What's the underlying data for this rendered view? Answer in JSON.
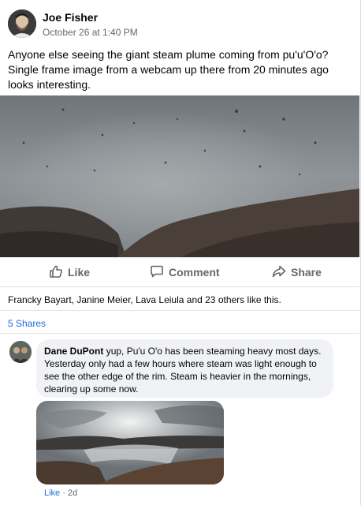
{
  "post": {
    "author": "Joe Fisher",
    "timestamp": "October 26 at 1:40 PM",
    "text": "Anyone else seeing the giant steam plume coming from pu'u'O'o? Single frame image from a webcam up there from 20 minutes ago looks interesting."
  },
  "actions": {
    "like": "Like",
    "comment": "Comment",
    "share": "Share"
  },
  "reactions": {
    "summary": "Francky Bayart, Janine Meier, Lava Leiula and 23 others like this."
  },
  "shares": {
    "label": "5 Shares"
  },
  "comment": {
    "author": "Dane DuPont",
    "text": "yup, Pu'u O'o has been steaming heavy most days. Yesterday only had a few hours where steam was light enough to see the other edge of the rim. Steam is heavier in the mornings, clearing up some now.",
    "like_label": "Like",
    "separator": "·",
    "age": "2d"
  },
  "icons": [
    "thumbs-up-icon",
    "comment-icon",
    "share-icon"
  ],
  "colors": {
    "link": "#216fdb",
    "muted": "#65676b",
    "bubble": "#f0f2f5"
  }
}
